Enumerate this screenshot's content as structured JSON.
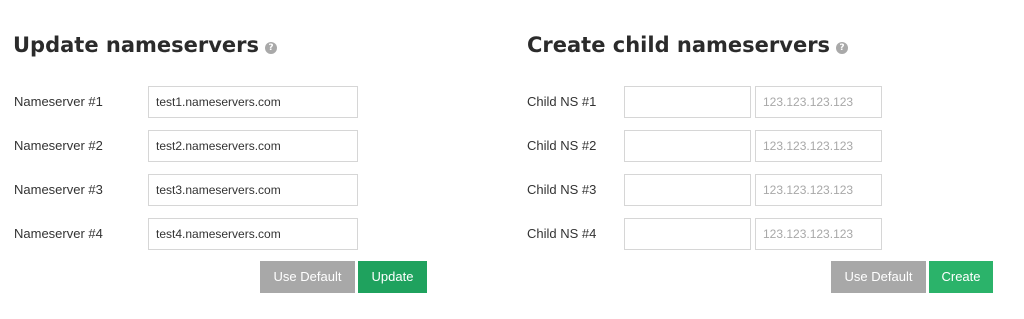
{
  "update_nameservers": {
    "title": "Update nameservers",
    "help_icon": "question-circle-icon",
    "rows": [
      {
        "label": "Nameserver #1",
        "value": "test1.nameservers.com"
      },
      {
        "label": "Nameserver #2",
        "value": "test2.nameservers.com"
      },
      {
        "label": "Nameserver #3",
        "value": "test3.nameservers.com"
      },
      {
        "label": "Nameserver #4",
        "value": "test4.nameservers.com"
      }
    ],
    "use_default_label": "Use Default",
    "update_label": "Update"
  },
  "create_child_nameservers": {
    "title": "Create child nameservers",
    "help_icon": "question-circle-icon",
    "rows": [
      {
        "label": "Child NS #1",
        "name_value": "",
        "ip_placeholder": "123.123.123.123"
      },
      {
        "label": "Child NS #2",
        "name_value": "",
        "ip_placeholder": "123.123.123.123"
      },
      {
        "label": "Child NS #3",
        "name_value": "",
        "ip_placeholder": "123.123.123.123"
      },
      {
        "label": "Child NS #4",
        "name_value": "",
        "ip_placeholder": "123.123.123.123"
      }
    ],
    "use_default_label": "Use Default",
    "create_label": "Create"
  },
  "colors": {
    "gray_button": "#a8a8a8",
    "update_button": "#1fa25e",
    "create_button": "#2bb36a",
    "help_icon": "#a9a9a9"
  }
}
